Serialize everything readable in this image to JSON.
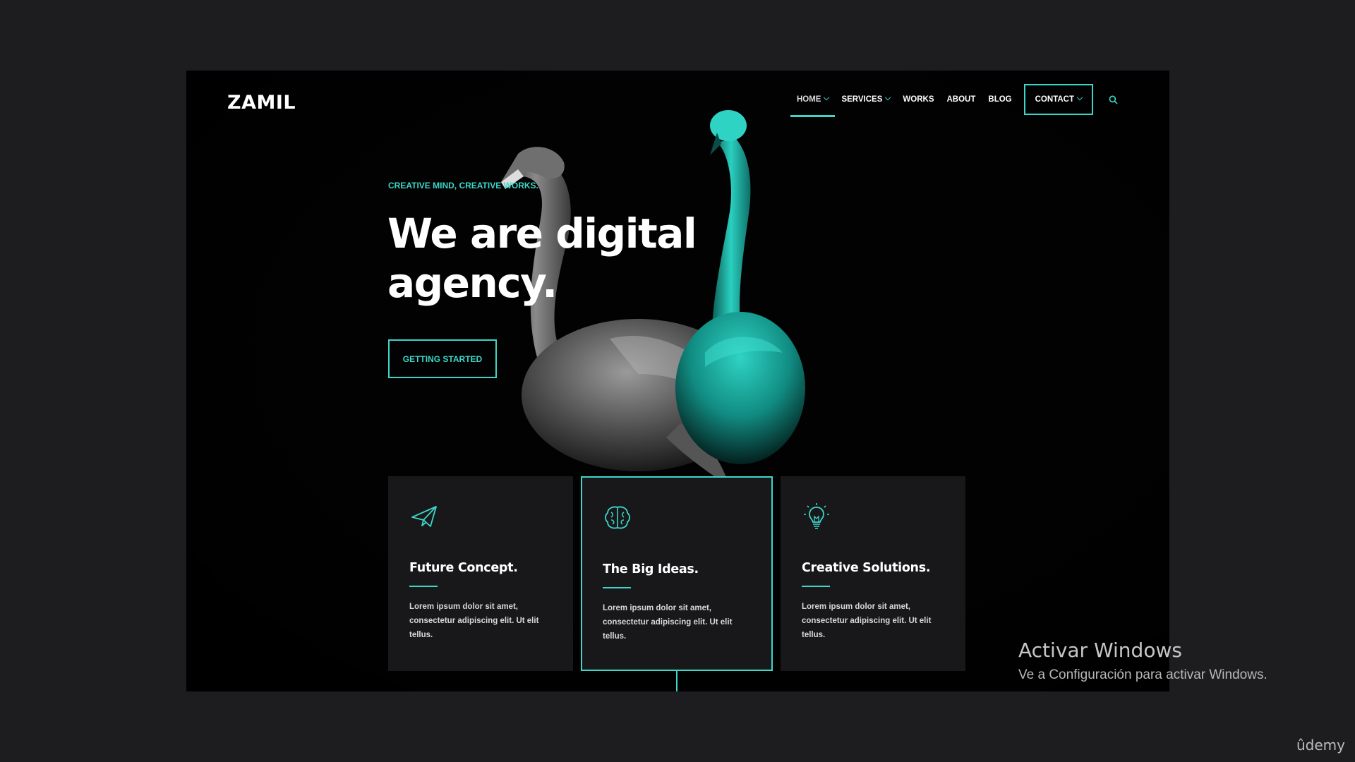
{
  "brand": {
    "logo": "ZAMIL",
    "accent": "#3dd6c9"
  },
  "nav": {
    "items": [
      {
        "label": "HOME",
        "dropdown": true,
        "active": true
      },
      {
        "label": "SERVICES",
        "dropdown": true
      },
      {
        "label": "WORKS"
      },
      {
        "label": "ABOUT"
      },
      {
        "label": "BLOG"
      },
      {
        "label": "CONTACT",
        "dropdown": true,
        "boxed": true
      }
    ],
    "search_icon": "search-icon"
  },
  "hero": {
    "tagline": "CREATIVE MIND, CREATIVE WORKS.",
    "title_line1": "We are digital",
    "title_line2": "agency.",
    "cta": "GETTING STARTED"
  },
  "cards": [
    {
      "icon": "paper-plane-icon",
      "title": "Future Concept.",
      "text": "Lorem ipsum dolor sit amet, consectetur adipiscing elit. Ut elit tellus."
    },
    {
      "icon": "brain-icon",
      "title": "The Big Ideas.",
      "text": "Lorem ipsum dolor sit amet, consectetur adipiscing elit. Ut elit tellus.",
      "highlighted": true
    },
    {
      "icon": "lightbulb-icon",
      "title": "Creative Solutions.",
      "text": "Lorem ipsum dolor sit amet, consectetur adipiscing elit. Ut elit tellus."
    }
  ],
  "overlay": {
    "activate_title": "Activar Windows",
    "activate_sub": "Ve a Configuración para activar Windows.",
    "watermark": "ûdemy"
  }
}
